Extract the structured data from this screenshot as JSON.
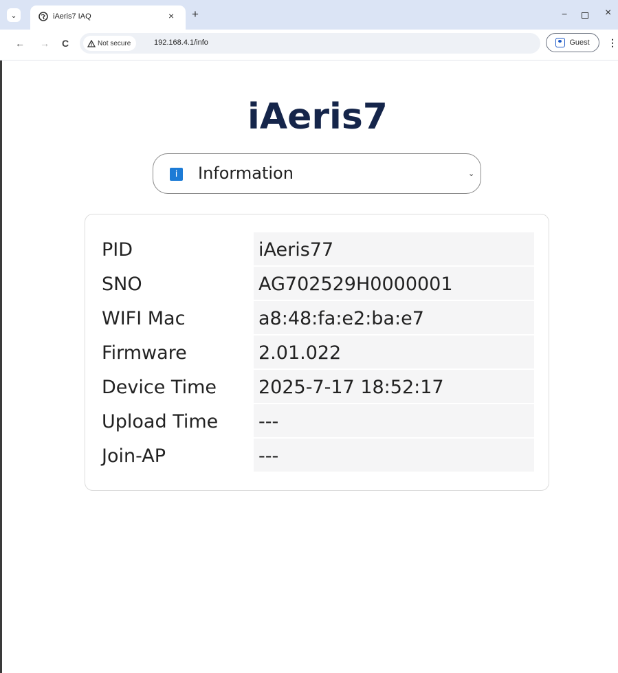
{
  "browser": {
    "tab": {
      "title": "iAeris7 IAQ",
      "close": "×"
    },
    "new_tab": "+",
    "window_controls": {
      "minimize": "−",
      "close": "×"
    },
    "nav": {
      "back": "←",
      "forward": "→",
      "reload": "C"
    },
    "security_label": "Not secure",
    "url": "192.168.4.1/info",
    "profile_label": "Guest",
    "menu": "⋮"
  },
  "page": {
    "title": "iAeris7",
    "selector": {
      "icon": "info-icon",
      "icon_glyph": "i",
      "label": "Information"
    }
  },
  "info_table": [
    {
      "label": "PID",
      "value": "iAeris77"
    },
    {
      "label": "SNO",
      "value": "AG702529H0000001"
    },
    {
      "label": "WIFI Mac",
      "value": "a8:48:fa:e2:ba:e7"
    },
    {
      "label": "Firmware",
      "value": "2.01.022"
    },
    {
      "label": "Device Time",
      "value": "2025-7-17 18:52:17"
    },
    {
      "label": "Upload Time",
      "value": "---"
    },
    {
      "label": "Join-AP",
      "value": "---"
    }
  ],
  "colors": {
    "title": "#15254a",
    "info_icon": "#1c7bd6",
    "tabbar": "#dbe4f5",
    "value_cell": "#f5f5f6"
  }
}
